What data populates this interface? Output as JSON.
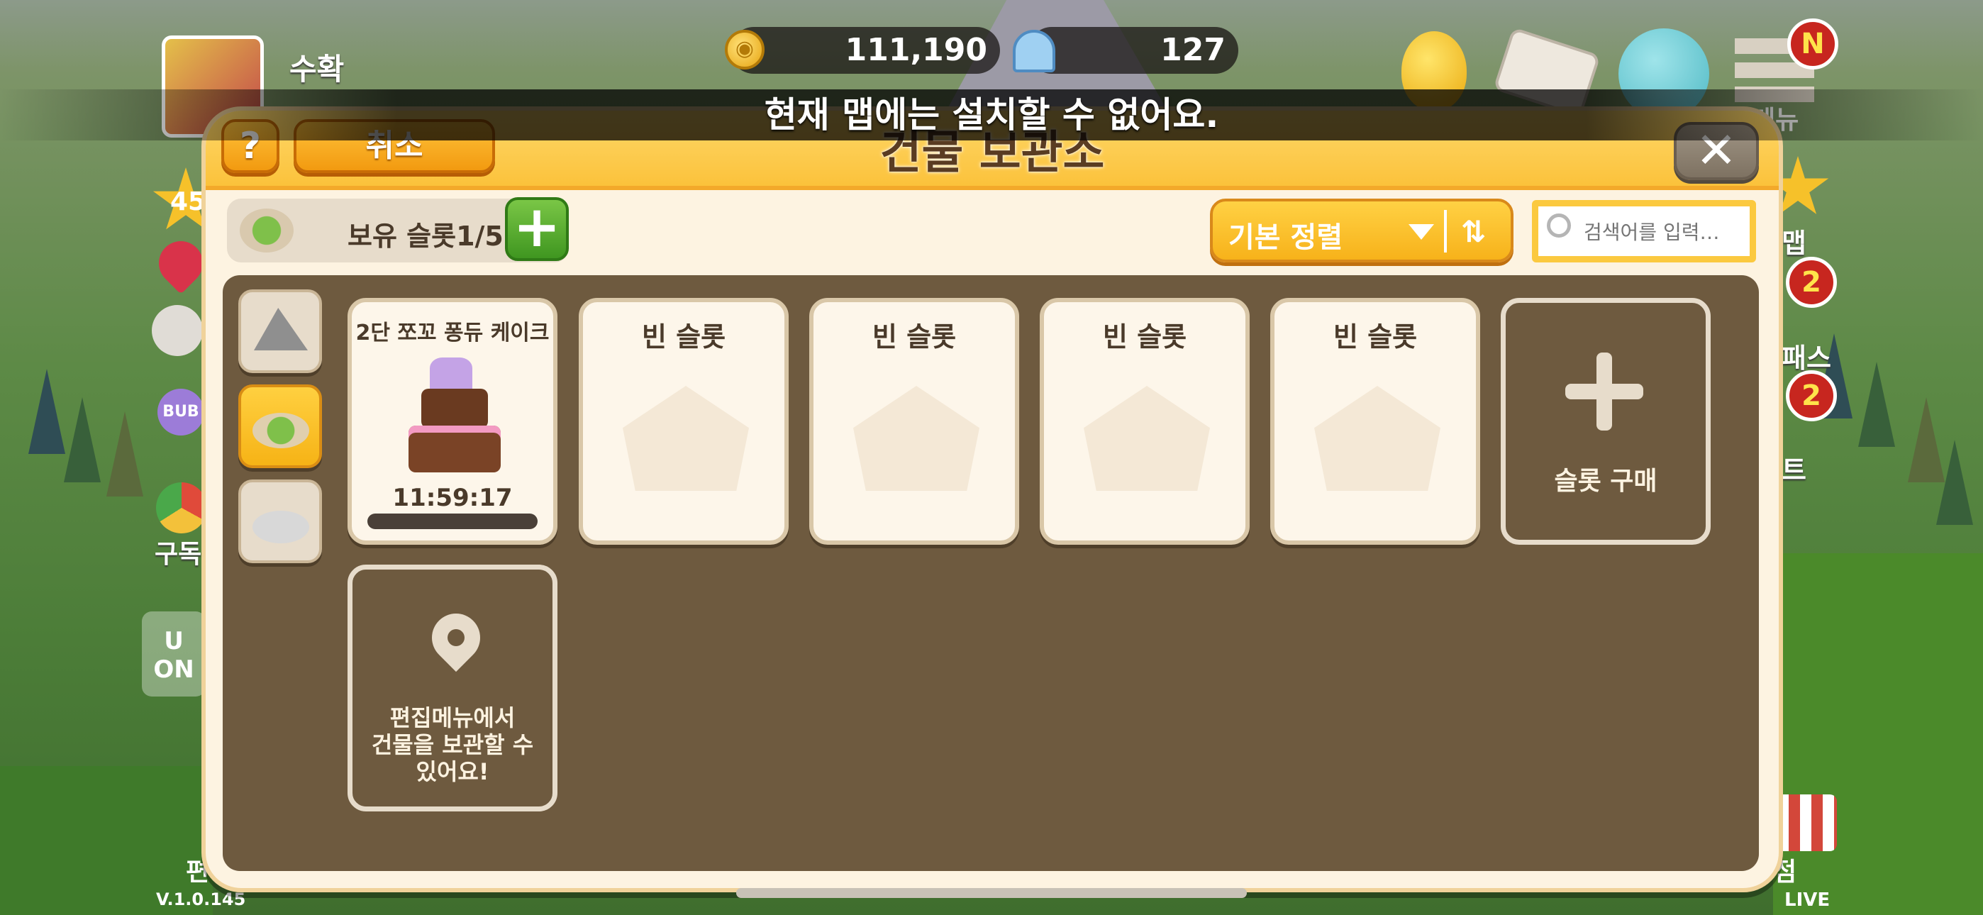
{
  "hud": {
    "profile_name": "수확",
    "coins": "111,190",
    "gems": "127",
    "menu_badge": "N",
    "side_badge_1": "2",
    "side_badge_2": "2",
    "left_level_partial": "45",
    "left_label_partial": "구독",
    "right_label_map_partial": "맵",
    "right_label_2_partial": "패스",
    "right_label_3_partial": "트",
    "menu_label_partial": "메뉴",
    "edit_label_partial": "편",
    "shop_label_partial": "점",
    "bubble_partial": "BUB",
    "left_badge_partial": "U\nON",
    "version": "V.1.0.145",
    "live": "LIVE"
  },
  "toast": "현재 맵에는 설치할 수 없어요.",
  "modal": {
    "title": "건물 보관소",
    "help_label": "?",
    "cancel_label": "취소",
    "close_label": "✕",
    "slot_count": "보유 슬롯1/5",
    "add_slot_label": "+",
    "sort_label": "기본 정렬",
    "search_placeholder": "검색어를 입력…"
  },
  "categories": [
    {
      "name": "mountain-category",
      "selected": false
    },
    {
      "name": "building-category",
      "selected": true
    },
    {
      "name": "island-category",
      "selected": false
    }
  ],
  "stored_item": {
    "title": "2단 쪼꼬 퐁듀 케이크",
    "timer": "11:59:17",
    "progress": 0
  },
  "empty_slots": [
    "빈 슬롯",
    "빈 슬롯",
    "빈 슬롯",
    "빈 슬롯"
  ],
  "buy_slot_label": "슬롯 구매",
  "edit_hint": "편집메뉴에서\n건물을 보관할 수\n있어요!",
  "colors": {
    "header": "#fbc23b",
    "panel": "#6e5a3f",
    "card": "#fdf6ea",
    "accent_orange": "#f29a10",
    "accent_green": "#3f9620"
  }
}
